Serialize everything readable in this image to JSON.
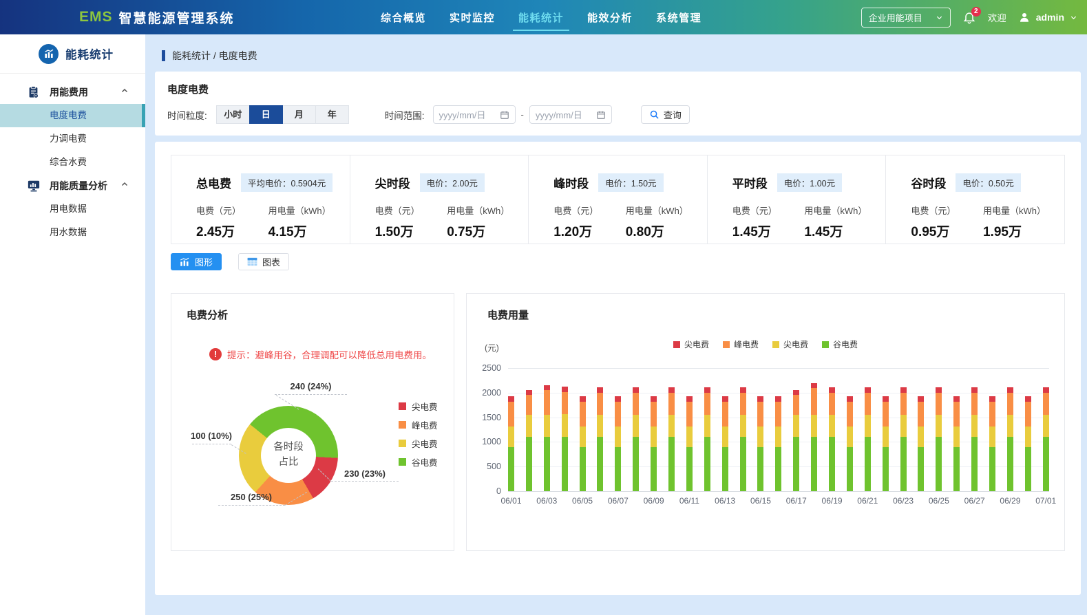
{
  "header": {
    "logo_ems": "EMS",
    "logo_title": "智慧能源管理系统",
    "nav": [
      {
        "label": "综合概览",
        "active": false
      },
      {
        "label": "实时监控",
        "active": false
      },
      {
        "label": "能耗统计",
        "active": true
      },
      {
        "label": "能效分析",
        "active": false
      },
      {
        "label": "系统管理",
        "active": false
      }
    ],
    "project_select": "企业用能项目",
    "notification_count": "2",
    "welcome": "欢迎",
    "username": "admin"
  },
  "sidebar": {
    "title": "能耗统计",
    "groups": [
      {
        "label": "用能费用",
        "icon": "clipboard-icon",
        "items": [
          {
            "label": "电度电费",
            "active": true
          },
          {
            "label": "力调电费",
            "active": false
          },
          {
            "label": "综合水费",
            "active": false
          }
        ]
      },
      {
        "label": "用能质量分析",
        "icon": "monitor-icon",
        "items": [
          {
            "label": "用电数据",
            "active": false
          },
          {
            "label": "用水数据",
            "active": false
          }
        ]
      }
    ]
  },
  "breadcrumb": "能耗统计 / 电度电费",
  "filter": {
    "title": "电度电费",
    "granularity_label": "时间粒度:",
    "granularity_options": [
      {
        "label": "小时",
        "active": false
      },
      {
        "label": "日",
        "active": true
      },
      {
        "label": "月",
        "active": false
      },
      {
        "label": "年",
        "active": false
      }
    ],
    "range_label": "时间范围:",
    "date_placeholder": "yyyy/mm/日",
    "separator": "-",
    "query_label": "查询"
  },
  "stats": {
    "fee_label": "电费（元）",
    "usage_label": "用电量（kWh）",
    "cards": [
      {
        "title": "总电费",
        "badge": "平均电价：0.5904元",
        "fee": "2.45万",
        "usage": "4.15万"
      },
      {
        "title": "尖时段",
        "badge": "电价：2.00元",
        "fee": "1.50万",
        "usage": "0.75万"
      },
      {
        "title": "峰时段",
        "badge": "电价：1.50元",
        "fee": "1.20万",
        "usage": "0.80万"
      },
      {
        "title": "平时段",
        "badge": "电价：1.00元",
        "fee": "1.45万",
        "usage": "1.45万"
      },
      {
        "title": "谷时段",
        "badge": "电价：0.50元",
        "fee": "0.95万",
        "usage": "1.95万"
      }
    ]
  },
  "view_toggle": {
    "chart_label": "图形",
    "table_label": "图表"
  },
  "colors": {
    "header_gradient_left": "#15337f",
    "header_gradient_right": "#74b93f",
    "brand_green": "#8dc63f",
    "nav_active": "#6fdcef",
    "sidebar_active_bg": "#b5dbe2",
    "sidebar_active_border": "#38a2b4",
    "primary_blue": "#2490f1",
    "navy": "#1b4c9a",
    "badge_bg": "#e0eefb",
    "tip_red": "#ef4747",
    "series_red": "#dc3a45",
    "series_orange": "#f98e45",
    "series_yellow": "#e9cc3d",
    "series_green": "#6fc32e"
  },
  "chart_data": [
    {
      "type": "pie",
      "title": "电费分析",
      "tip": "提示：避峰用谷，合理调配可以降低总用电费用。",
      "center_line1": "各时段",
      "center_line2": "占比",
      "legend_position": "right",
      "slices": [
        {
          "key": "red",
          "name": "尖电费",
          "value": 230,
          "percent": "23%",
          "label": "230 (23%)",
          "color": "#dc3a45"
        },
        {
          "key": "orange",
          "name": "峰电费",
          "value": 250,
          "percent": "25%",
          "label": "250 (25%)",
          "color": "#f98e45"
        },
        {
          "key": "yellow",
          "name": "尖电费",
          "value": 100,
          "percent": "10%",
          "label": "100 (10%)",
          "color": "#e9cc3d"
        },
        {
          "key": "green",
          "name": "谷电费",
          "value": 240,
          "percent": "24%",
          "label": "240 (24%)",
          "color": "#6fc32e"
        }
      ],
      "draw": {
        "start_deg": -51,
        "segments": [
          {
            "key": "green",
            "color": "#6fc32e",
            "deg": 144
          },
          {
            "key": "red",
            "color": "#dc3a45",
            "deg": 57
          },
          {
            "key": "orange",
            "color": "#f98e45",
            "deg": 72
          },
          {
            "key": "yellow",
            "color": "#e9cc3d",
            "deg": 87
          }
        ]
      }
    },
    {
      "type": "bar",
      "stacked": true,
      "title": "电费用量",
      "ylabel": "(元)",
      "ylim": [
        0,
        2500
      ],
      "yticks": [
        0,
        500,
        1000,
        1500,
        2000,
        2500
      ],
      "grid": true,
      "legend_position": "top",
      "legend": [
        {
          "name": "尖电费",
          "color": "#dc3a45"
        },
        {
          "name": "峰电费",
          "color": "#f98e45"
        },
        {
          "name": "尖电费",
          "color": "#e9cc3d"
        },
        {
          "name": "谷电费",
          "color": "#6fc32e"
        }
      ],
      "categories": [
        "06/01",
        "06/02",
        "06/03",
        "06/04",
        "06/05",
        "06/06",
        "06/07",
        "06/08",
        "06/09",
        "06/10",
        "06/11",
        "06/12",
        "06/13",
        "06/14",
        "06/15",
        "06/16",
        "06/17",
        "06/18",
        "06/19",
        "06/20",
        "06/21",
        "06/22",
        "06/23",
        "06/24",
        "06/25",
        "06/26",
        "06/27",
        "06/28",
        "06/29",
        "06/30",
        "07/01"
      ],
      "x_label_every": 2,
      "series": [
        {
          "name": "谷电费",
          "color": "#6fc32e",
          "values": [
            900,
            1100,
            1100,
            1100,
            900,
            1100,
            900,
            1100,
            900,
            1100,
            900,
            1100,
            900,
            1100,
            900,
            900,
            1100,
            1100,
            1100,
            900,
            1100,
            900,
            1100,
            900,
            1100,
            900,
            1100,
            900,
            1100,
            900,
            1100
          ]
        },
        {
          "name": "尖电费",
          "color": "#e9cc3d",
          "values": [
            420,
            450,
            450,
            460,
            420,
            450,
            420,
            450,
            420,
            450,
            420,
            450,
            420,
            450,
            420,
            420,
            450,
            450,
            450,
            420,
            450,
            420,
            450,
            420,
            450,
            420,
            450,
            420,
            450,
            420,
            450
          ]
        },
        {
          "name": "峰电费",
          "color": "#f98e45",
          "values": [
            500,
            400,
            500,
            450,
            500,
            450,
            500,
            450,
            500,
            450,
            500,
            450,
            500,
            450,
            500,
            500,
            400,
            550,
            450,
            500,
            450,
            500,
            450,
            500,
            450,
            500,
            450,
            500,
            450,
            500,
            450
          ]
        },
        {
          "name": "尖电费",
          "color": "#dc3a45",
          "values": [
            110,
            110,
            100,
            110,
            110,
            110,
            110,
            110,
            110,
            110,
            110,
            110,
            110,
            110,
            110,
            110,
            110,
            100,
            110,
            110,
            110,
            110,
            110,
            110,
            110,
            110,
            110,
            110,
            110,
            110,
            110
          ]
        }
      ]
    }
  ]
}
